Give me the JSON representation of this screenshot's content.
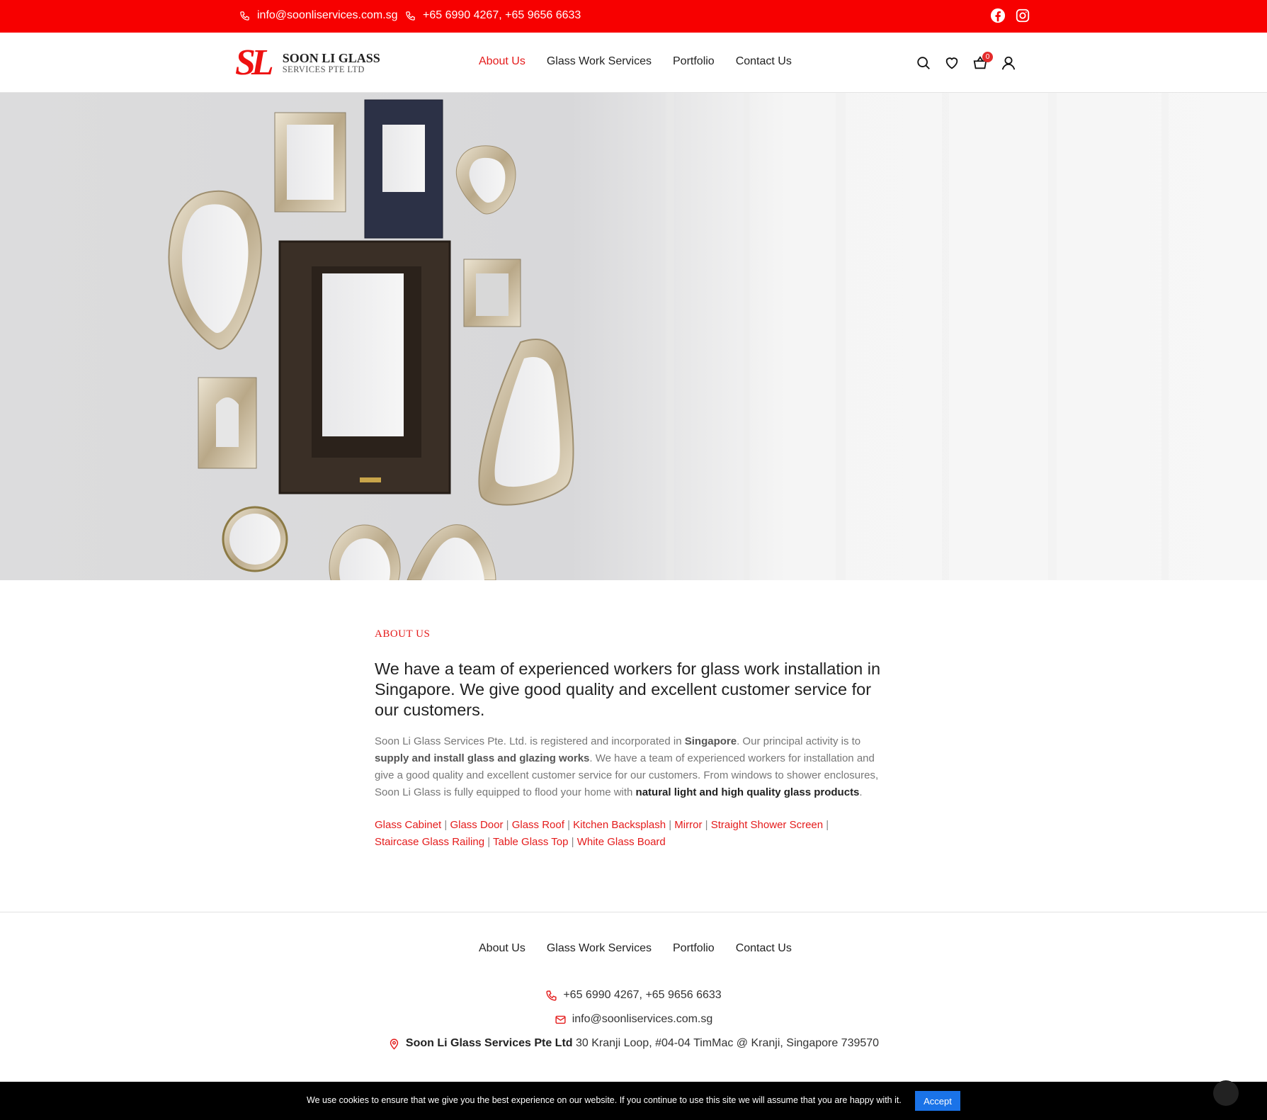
{
  "topbar": {
    "email": "info@soonliservices.com.sg",
    "phones": "+65 6990 4267, +65 9656 6633",
    "social": [
      "facebook-icon",
      "instagram-icon"
    ]
  },
  "header": {
    "logo_mark": "SL",
    "logo_name": "SOON LI GLASS",
    "logo_sub": "SERVICES PTE LTD",
    "nav": [
      {
        "label": "About Us",
        "active": true
      },
      {
        "label": "Glass Work Services",
        "active": false
      },
      {
        "label": "Portfolio",
        "active": false
      },
      {
        "label": "Contact Us",
        "active": false
      }
    ],
    "icons": [
      "search-icon",
      "heart-icon",
      "cart-icon",
      "user-icon"
    ],
    "cart_count": "0"
  },
  "about": {
    "eyebrow": "ABOUT US",
    "heading": "We have a team of experienced workers for glass work installation in Singapore. We give good quality and excellent customer service for our customers.",
    "para": {
      "t1": "Soon Li Glass Services Pte. Ltd. is registered and incorporated in ",
      "b1": "Singapore",
      "t2": ". Our principal activity is to ",
      "b2": "supply and install glass and glazing works",
      "t3": ". We have a team of experienced workers for installation and give a good quality and excellent customer service for our customers. From windows to shower enclosures, Soon Li Glass is fully equipped to flood your home with ",
      "b3": "natural light and high quality glass products",
      "t4": "."
    },
    "service_links": [
      "Glass Cabinet",
      "Glass Door",
      "Glass Roof",
      "Kitchen Backsplash",
      "Mirror",
      "Straight Shower Screen",
      "Staircase Glass Railing",
      "Table Glass Top",
      "White Glass Board"
    ]
  },
  "footer": {
    "nav": [
      "About Us",
      "Glass Work Services",
      "Portfolio",
      "Contact Us"
    ],
    "phones": "+65 6990 4267, +65 9656 6633",
    "email": "info@soonliservices.com.sg",
    "company": "Soon Li Glass Services Pte Ltd",
    "address": "30 Kranji Loop, #04-04 TimMac @ Kranji, Singapore 739570"
  },
  "cookie": {
    "text": "We use cookies to ensure that we give you the best experience on our website. If you continue to use this site we will assume that you are happy with it.",
    "accept": "Accept"
  },
  "colors": {
    "accent": "#f70000",
    "link": "#e41b1b",
    "accept_button": "#1a73e8"
  }
}
